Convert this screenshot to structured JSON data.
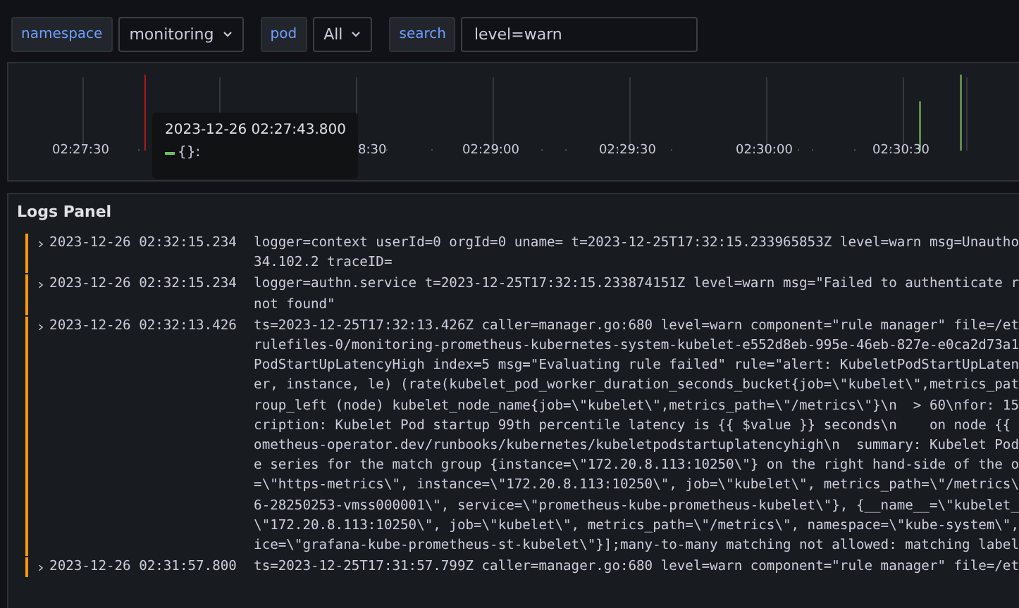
{
  "filters": [
    {
      "label": "namespace",
      "kind": "select",
      "value": "monitoring"
    },
    {
      "label": "pod",
      "kind": "select",
      "value": "All"
    },
    {
      "label": "search",
      "kind": "text",
      "value": "level=warn"
    }
  ],
  "volume_panel": {
    "ticks": [
      "02:27:30",
      "8:30",
      "02:29:00",
      "02:29:30",
      "02:30:00",
      "02:30:30"
    ],
    "tooltip": {
      "time": "2023-12-26 02:27:43.800",
      "series": "{}:"
    }
  },
  "logs_panel": {
    "title": "Logs Panel",
    "rows": [
      {
        "color": "#ff9900",
        "time": "2023-12-26 02:32:15.234",
        "lines": [
          "logger=context userId=0 orgId=0 uname= t=2023-12-25T17:32:15.233965853Z level=warn msg=Unautho",
          "34.102.2 traceID="
        ]
      },
      {
        "color": "#ff9900",
        "time": "2023-12-26 02:32:15.234",
        "lines": [
          "logger=authn.service t=2023-12-25T17:32:15.233874151Z level=warn msg=\"Failed to authenticate r",
          "not found\""
        ]
      },
      {
        "color": "#ff9900",
        "time": "2023-12-26 02:32:13.426",
        "lines": [
          "ts=2023-12-25T17:32:13.426Z caller=manager.go:680 level=warn component=\"rule manager\" file=/et",
          "rulefiles-0/monitoring-prometheus-kubernetes-system-kubelet-e552d8eb-995e-46eb-827e-e0ca2d73a1",
          "PodStartUpLatencyHigh index=5 msg=\"Evaluating rule failed\" rule=\"alert: KubeletPodStartUpLaten",
          "er, instance, le) (rate(kubelet_pod_worker_duration_seconds_bucket{job=\\\"kubelet\\\",metrics_pat",
          "roup_left (node) kubelet_node_name{job=\\\"kubelet\\\",metrics_path=\\\"/metrics\\\"}\\n  > 60\\nfor: 15",
          "cription: Kubelet Pod startup 99th percentile latency is {{ $value }} seconds\\n    on node {{",
          "ometheus-operator.dev/runbooks/kubernetes/kubeletpodstartuplatencyhigh\\n  summary: Kubelet Pod",
          "e series for the match group {instance=\\\"172.20.8.113:10250\\\"} on the right hand-side of the o",
          "=\\\"https-metrics\\\", instance=\\\"172.20.8.113:10250\\\", job=\\\"kubelet\\\", metrics_path=\\\"/metrics\\",
          "6-28250253-vmss000001\\\", service=\\\"prometheus-kube-prometheus-kubelet\\\"}, {__name__=\\\"kubelet_",
          "\\\"172.20.8.113:10250\\\", job=\\\"kubelet\\\", metrics_path=\\\"/metrics\\\", namespace=\\\"kube-system\\\",",
          "ice=\\\"grafana-kube-prometheus-st-kubelet\\\"}];many-to-many matching not allowed: matching label"
        ]
      },
      {
        "color": "#ff9900",
        "time": "2023-12-26 02:31:57.800",
        "lines": [
          "ts=2023-12-25T17:31:57.799Z caller=manager.go:680 level=warn component=\"rule manager\" file=/et"
        ]
      }
    ]
  }
}
